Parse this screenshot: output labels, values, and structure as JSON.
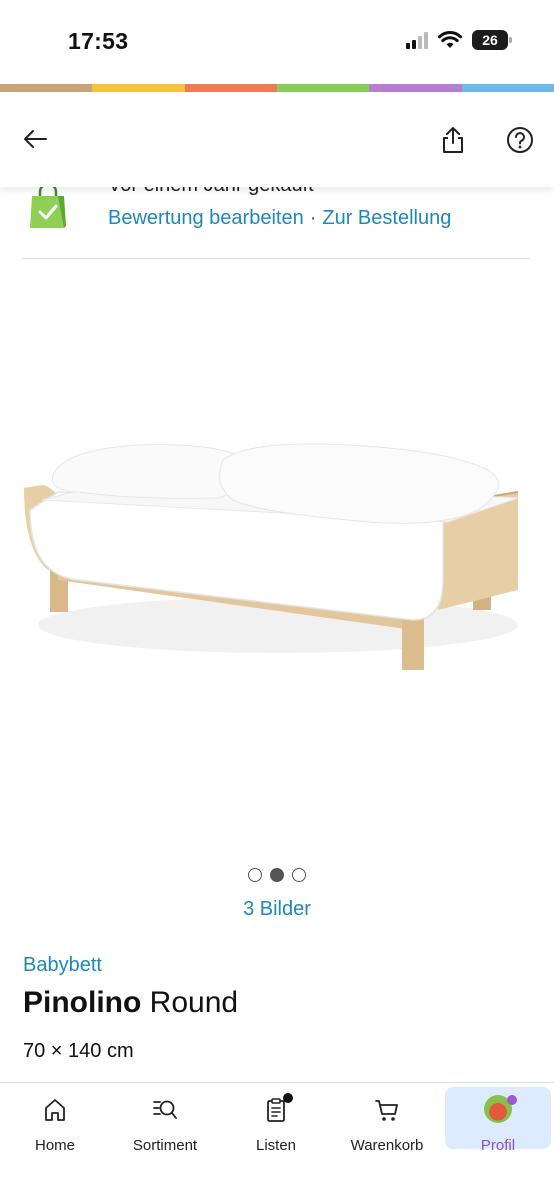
{
  "status_bar": {
    "time": "17:53",
    "battery": "26"
  },
  "color_strip": [
    "#c9a27a",
    "#f7c33c",
    "#ef7b55",
    "#88cc5c",
    "#b57fd1",
    "#6fb8ea"
  ],
  "header": {
    "back_icon": "arrow-left-icon",
    "share_icon": "share-icon",
    "help_icon": "help-icon"
  },
  "purchase": {
    "text": "Vor einem Jahr gekauft",
    "edit_review": "Bewertung bearbeiten",
    "separator": "·",
    "to_order": "Zur Bestellung"
  },
  "gallery": {
    "dots": 3,
    "active_index": 1,
    "count_label": "3 Bilder"
  },
  "product": {
    "category": "Babybett",
    "brand": "Pinolino",
    "name": "Round",
    "size": "70 × 140 cm"
  },
  "bottom_nav": {
    "items": [
      {
        "label": "Home",
        "icon": "home-icon"
      },
      {
        "label": "Sortiment",
        "icon": "search-list-icon"
      },
      {
        "label": "Listen",
        "icon": "clipboard-icon"
      },
      {
        "label": "Warenkorb",
        "icon": "cart-icon"
      },
      {
        "label": "Profil",
        "icon": "avatar"
      }
    ],
    "active": "Profil"
  },
  "colors": {
    "link": "#1e88b8",
    "accent_purple": "#8a4fc6",
    "active_bg": "#dcebff"
  }
}
